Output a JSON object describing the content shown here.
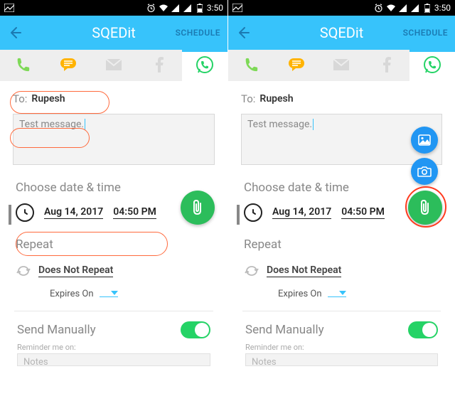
{
  "status_bar": {
    "time": "3:50"
  },
  "app": {
    "title": "SQEDit",
    "schedule_label": "SCHEDULE"
  },
  "compose": {
    "to_label": "To:",
    "to_value": "Rupesh",
    "message_placeholder": "Test message.",
    "choose_dt_label": "Choose date & time",
    "date_value": "Aug 14, 2017",
    "time_value": "04:50 PM",
    "repeat_label": "Repeat",
    "repeat_value": "Does Not Repeat",
    "expires_label": "Expires On",
    "send_manually_label": "Send Manually",
    "reminder_label": "Reminder me on:",
    "notes_placeholder": "Notes"
  },
  "icons": {
    "phone": "phone-icon",
    "sms": "sms-icon",
    "mail": "mail-icon",
    "fb": "facebook-icon",
    "wa": "whatsapp-icon",
    "attach": "paperclip-icon",
    "gallery": "image-icon",
    "camera": "camera-icon",
    "clock": "clock-icon",
    "refresh": "refresh-icon"
  }
}
